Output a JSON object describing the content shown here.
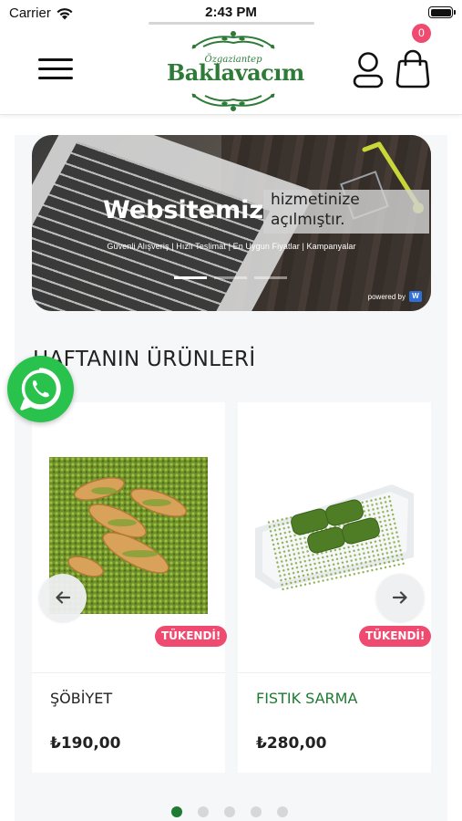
{
  "status_bar": {
    "carrier": "Carrier",
    "time": "2:43 PM"
  },
  "header": {
    "logo_subtitle": "Özgaziantep",
    "logo_title": "Baklavacım",
    "cart_count": "0",
    "brand_color": "#2e7a37"
  },
  "banner": {
    "headline": "Websitemiz",
    "headline_box_line1": "hizmetinize",
    "headline_box_line2": "açılmıştır.",
    "tagline": "Güvenli Alışveriş | Hızlı Teslimat | En Uygun Fiyatlar | Kampanyalar",
    "powered_by": "powered by",
    "slide_count": 3,
    "active_slide": 1
  },
  "section": {
    "title": "HAFTANIN ÜRÜNLERİ"
  },
  "products": [
    {
      "name": "ŞÖBİYET",
      "price": "₺190,00",
      "badge": "TÜKENDİ!",
      "name_color": "#222222"
    },
    {
      "name": "FISTIK SARMA",
      "price": "₺280,00",
      "badge": "TÜKENDİ!",
      "name_color": "#1f7a32"
    }
  ],
  "carousel": {
    "page_count": 5,
    "active_page": 1,
    "prev_icon": "arrow-left-icon",
    "next_icon": "arrow-right-icon"
  },
  "colors": {
    "badge": "#ef4a6f",
    "whatsapp": "#29c24c",
    "pager_active": "#1f7a32"
  }
}
